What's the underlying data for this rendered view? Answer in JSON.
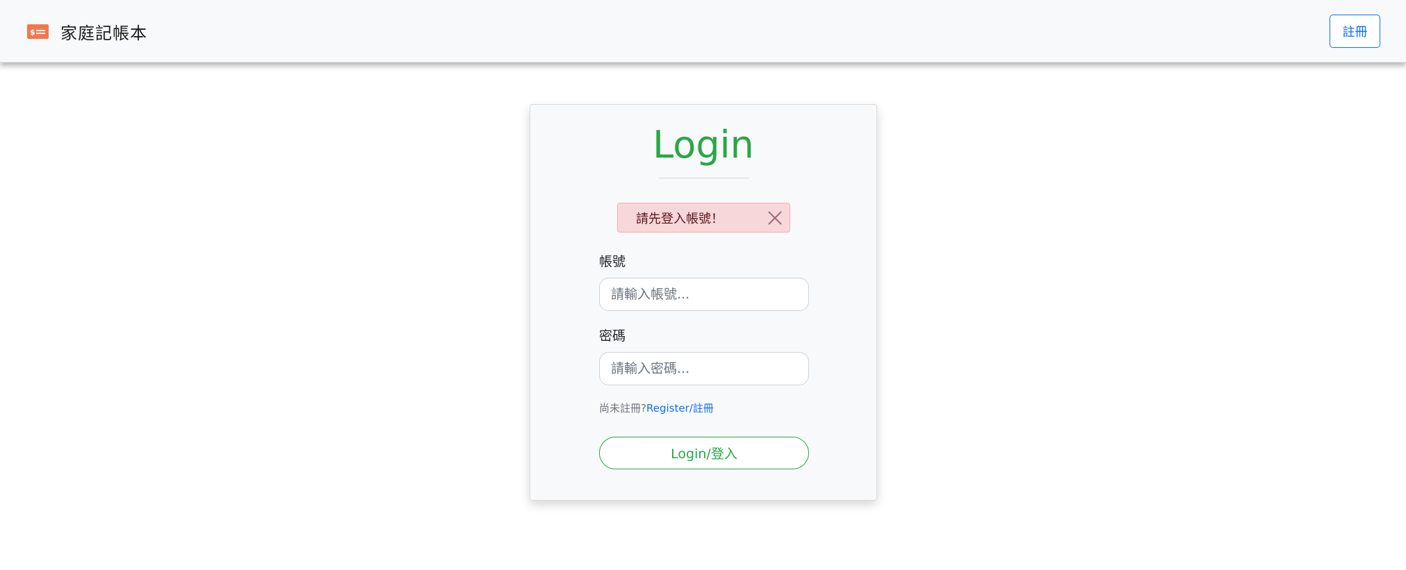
{
  "navbar": {
    "brand_icon": "money-bill-icon",
    "brand_text": "家庭記帳本",
    "register_label": "註冊",
    "accent_color": "#0d6efd",
    "brand_icon_color": "#f2784b"
  },
  "login": {
    "title": "Login",
    "title_color": "#28a745",
    "alert_text": "請先登入帳號！",
    "alert_close_icon": "close-icon",
    "account_label": "帳號",
    "account_placeholder": "請輸入帳號...",
    "password_label": "密碼",
    "password_placeholder": "請輸入密碼...",
    "register_prompt": "尚未註冊?",
    "register_link": "Register/註冊",
    "submit_label": "Login/登入"
  }
}
